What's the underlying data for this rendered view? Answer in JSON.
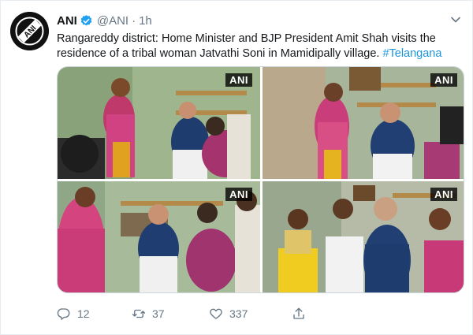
{
  "author": {
    "name": "ANI",
    "handle": "@ANI",
    "separator": "·",
    "time": "1h",
    "avatar_text": "ANI"
  },
  "tweet": {
    "text": "Rangareddy district: Home Minister and BJP President Amit Shah visits the residence of a tribal woman Jatvathi Soni in Mamidipally village.",
    "hashtag": "#Telangana"
  },
  "media": {
    "watermarks": [
      "ANI",
      "ANI",
      "ANI",
      "ANI"
    ]
  },
  "actions": {
    "reply_count": "12",
    "retweet_count": "37",
    "like_count": "337"
  },
  "icons": {
    "verified": "verified-badge-icon",
    "caret": "chevron-down-icon",
    "reply": "reply-icon",
    "retweet": "retweet-icon",
    "like": "heart-icon",
    "share": "share-icon"
  },
  "colors": {
    "link": "#1b95e0",
    "verified": "#1da1f2",
    "secondary_text": "#657786"
  }
}
